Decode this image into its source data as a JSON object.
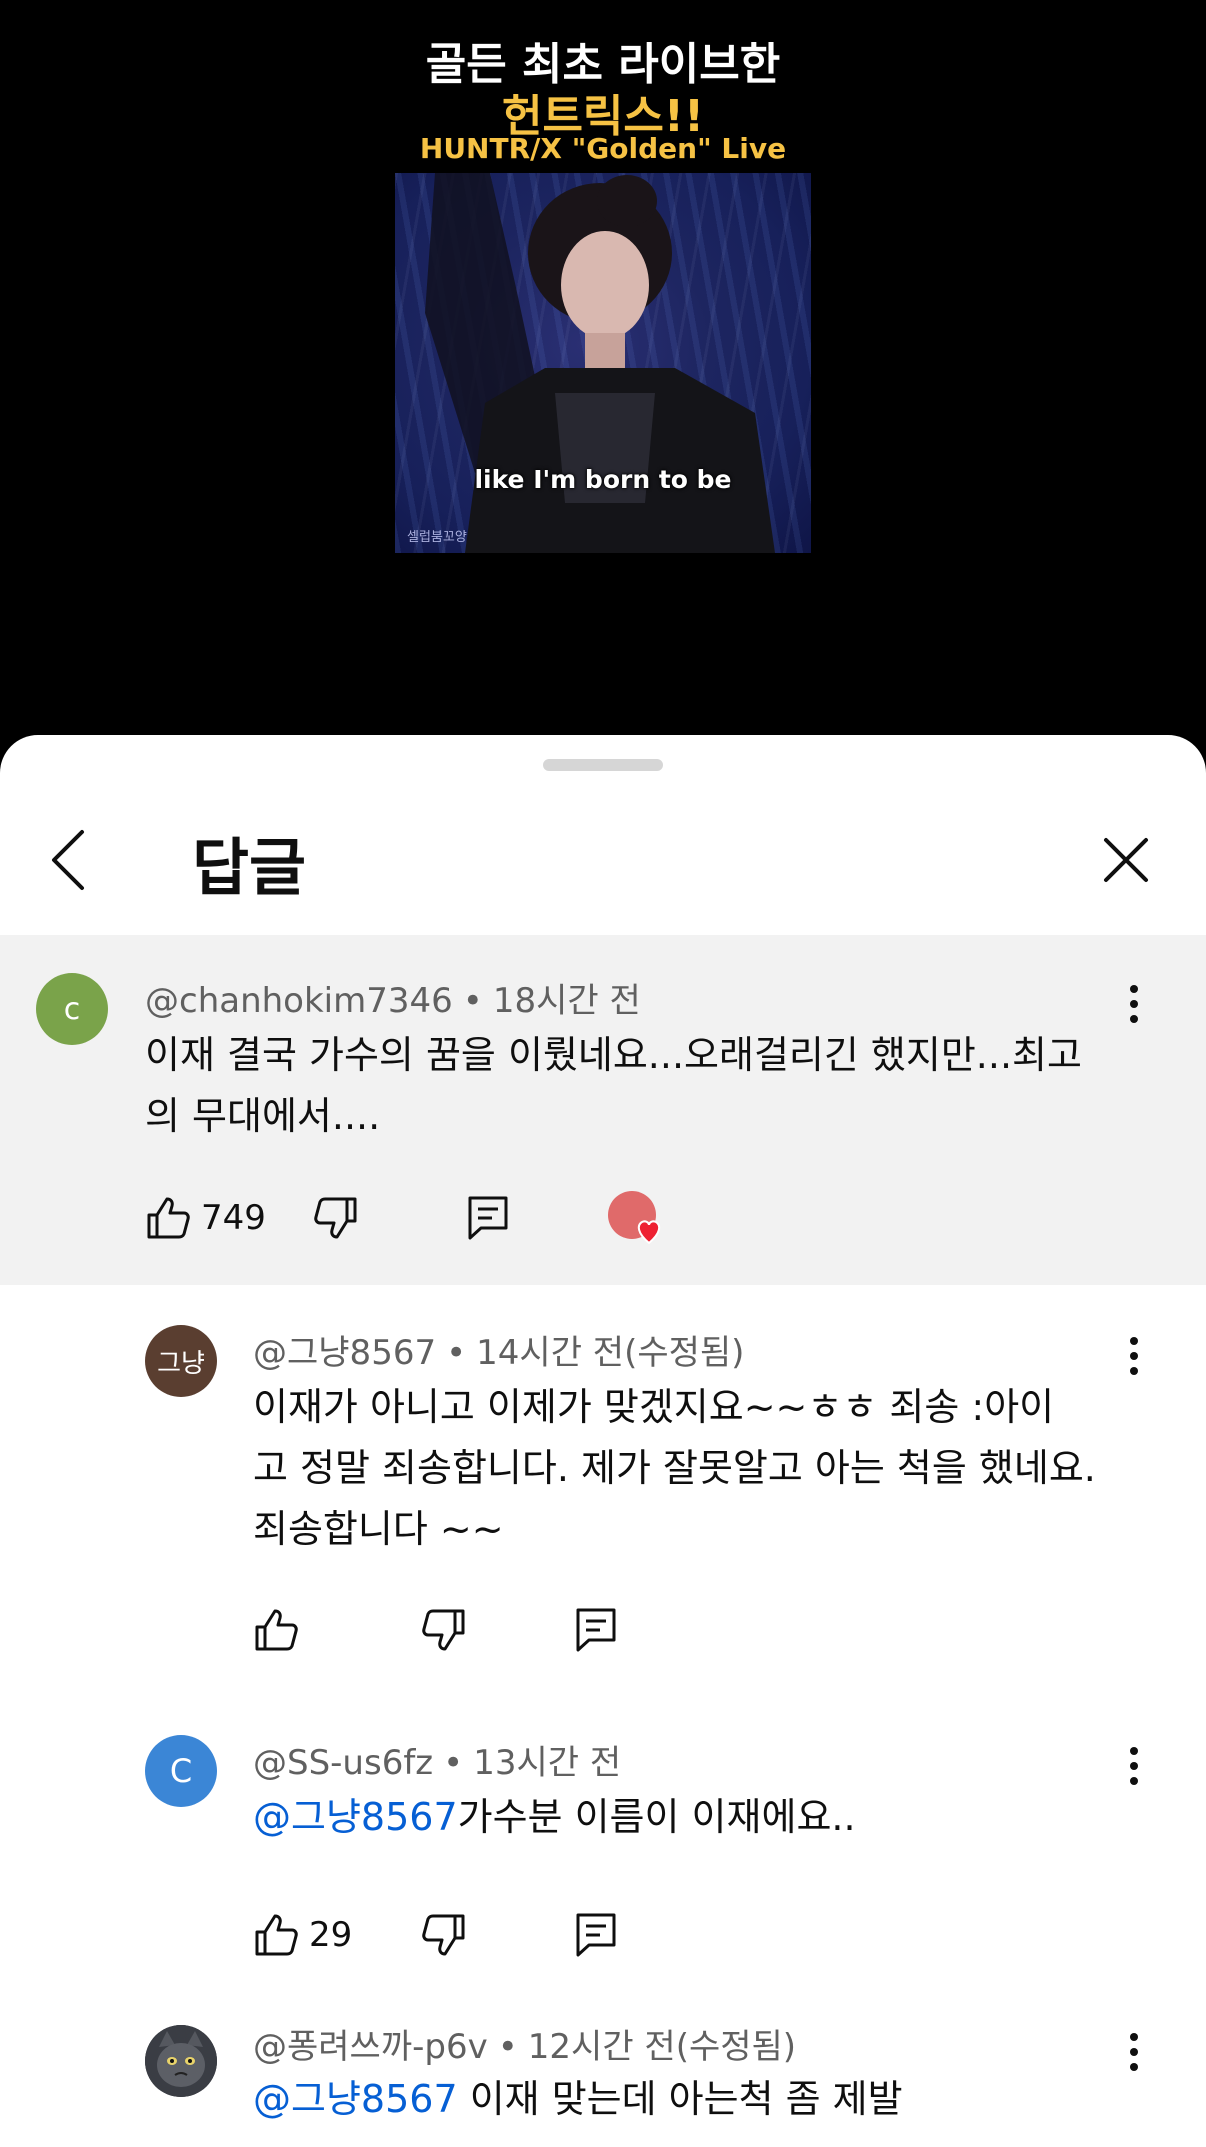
{
  "video": {
    "title_line1": "골든 최초 라이브한",
    "title_line2": "헌트릭스!!",
    "title_line3": "HUNTR/X \"Golden\" Live",
    "caption": "like I'm born to be",
    "watermark": "셀럽붐꼬양"
  },
  "header": {
    "title": "답글"
  },
  "parent_comment": {
    "avatar_letter": "c",
    "avatar_color": "#7aa34a",
    "author": "@chanhokim7346",
    "time": "18시간 전",
    "text_line1": "이재 결국 가수의 꿈을 이뤘네요...오래걸리긴 했지만...최고",
    "text_line2": "의 무대에서....",
    "likes": "749",
    "creator_heart": true
  },
  "replies": [
    {
      "avatar_text": "그냥",
      "avatar_color": "#5a3e30",
      "author": "@그냥8567",
      "time": "14시간 전(수정됨)",
      "text_line1": "이재가 아니고 이제가 맞겠지요~~ㅎㅎ 죄송  :아이",
      "text_line2": "고 정말 죄송합니다. 제가 잘못알고 아는 척을 했네요.",
      "text_line3": "죄송합니다 ~~",
      "likes": ""
    },
    {
      "avatar_text": "C",
      "avatar_color": "#3b86d6",
      "author": "@SS-us6fz",
      "time": "13시간 전",
      "mention": "@그냥8567",
      "text": "가수분 이름이 이재에요..",
      "likes": "29"
    },
    {
      "avatar_icon": "cat-avatar-icon",
      "author": "@퐁려쓰까-p6v",
      "time": "12시간 전(수정됨)",
      "mention": "@그냥8567",
      "text": " 이재 맞는데 아는척 좀 제발"
    }
  ]
}
